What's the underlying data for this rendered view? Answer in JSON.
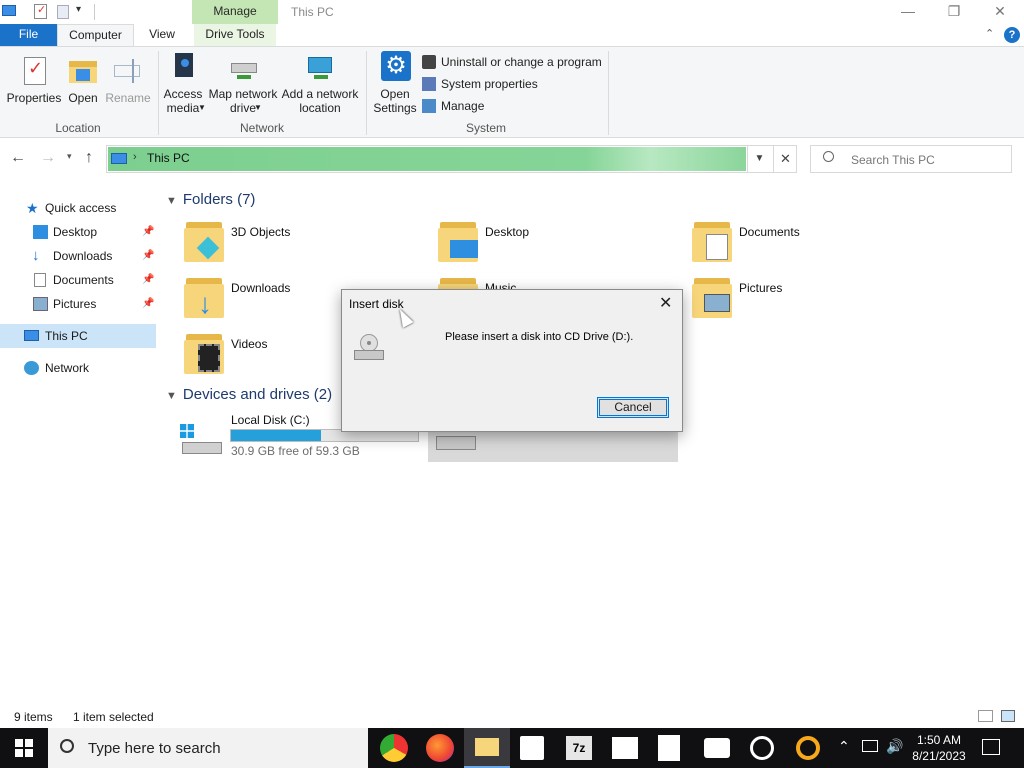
{
  "window": {
    "title": "This PC",
    "context_tab": "Manage",
    "controls": {
      "minimize": "—",
      "restore": "❐",
      "close": "✕"
    }
  },
  "tabs": [
    {
      "label": "File"
    },
    {
      "label": "Computer"
    },
    {
      "label": "View"
    },
    {
      "label": "Drive Tools"
    }
  ],
  "ribbon": {
    "location": {
      "label": "Location",
      "properties": "Properties",
      "open": "Open",
      "rename": "Rename"
    },
    "network": {
      "label": "Network",
      "access_media": "Access\nmedia",
      "map_drive": "Map network\ndrive",
      "add_location": "Add a network\nlocation"
    },
    "system": {
      "label": "System",
      "open_settings": "Open\nSettings",
      "uninstall": "Uninstall or change a program",
      "system_properties": "System properties",
      "manage": "Manage"
    }
  },
  "address": {
    "path": "This PC",
    "search_placeholder": "Search This PC"
  },
  "sidebar": {
    "quick_access": "Quick access",
    "items": [
      {
        "label": "Desktop"
      },
      {
        "label": "Downloads"
      },
      {
        "label": "Documents"
      },
      {
        "label": "Pictures"
      }
    ],
    "this_pc": "This PC",
    "network": "Network"
  },
  "folders": {
    "header": "Folders (7)",
    "items": [
      {
        "label": "3D Objects"
      },
      {
        "label": "Desktop"
      },
      {
        "label": "Documents"
      },
      {
        "label": "Downloads"
      },
      {
        "label": "Music"
      },
      {
        "label": "Pictures"
      },
      {
        "label": "Videos"
      }
    ]
  },
  "drives": {
    "header": "Devices and drives (2)",
    "local": {
      "label": "Local Disk (C:)",
      "free": "30.9 GB free of 59.3 GB",
      "used_fraction": 0.48
    }
  },
  "dialog": {
    "title": "Insert disk",
    "message": "Please insert a disk into CD Drive (D:).",
    "cancel": "Cancel"
  },
  "status": {
    "items": "9 items",
    "selected": "1 item selected"
  },
  "taskbar": {
    "search_placeholder": "Type here to search",
    "time": "1:50 AM",
    "date": "8/21/2023"
  },
  "colors": {
    "accent": "#1a73c8",
    "address_fill": "#7ccf8e",
    "progress": "#26a0da"
  }
}
